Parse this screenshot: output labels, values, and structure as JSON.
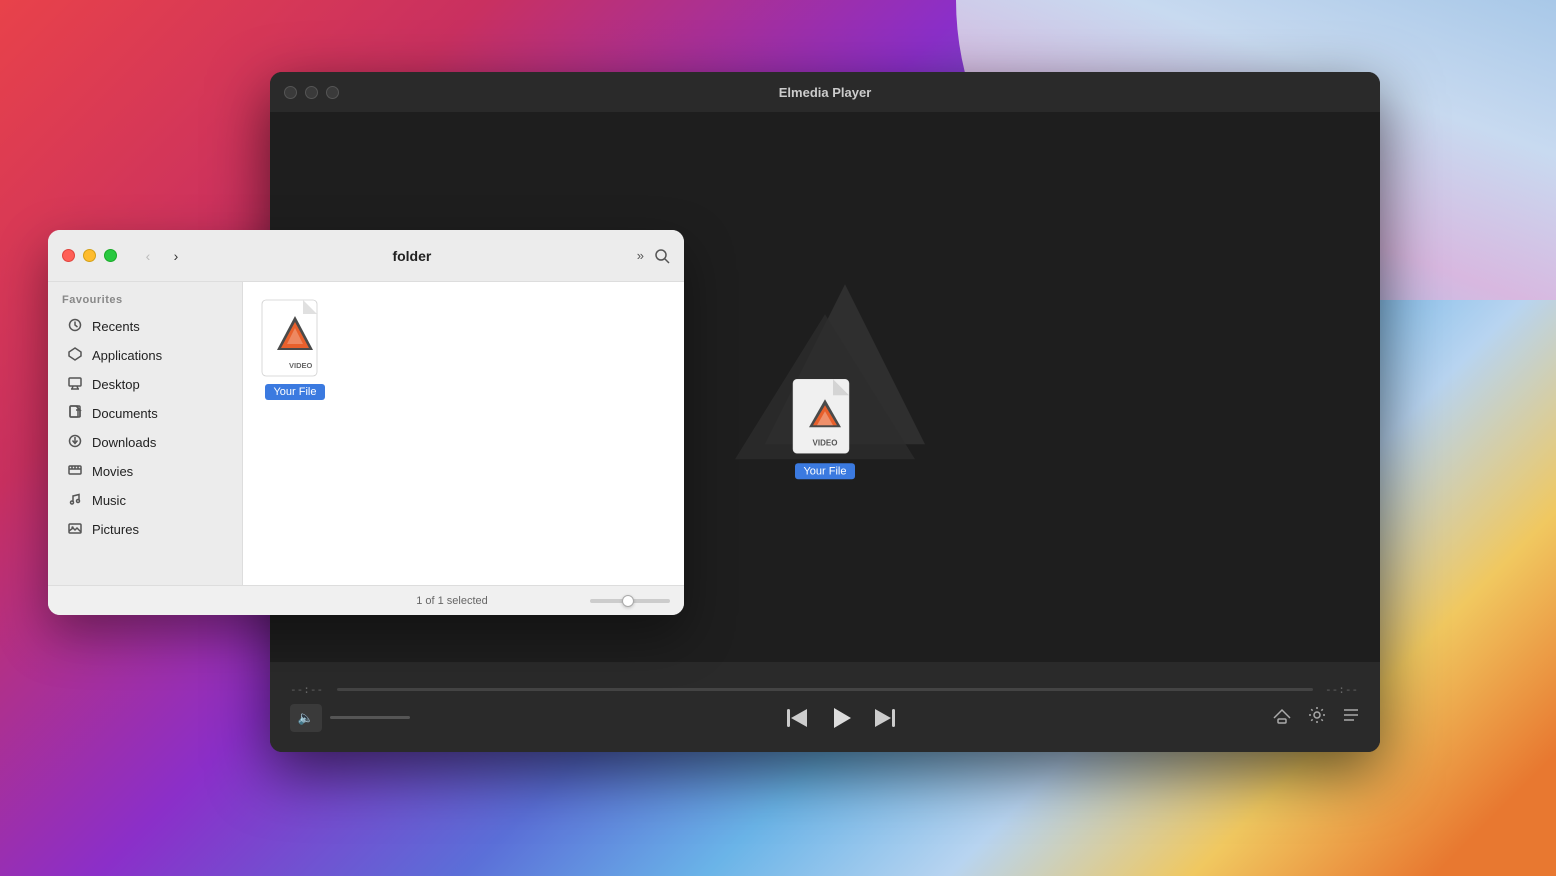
{
  "wallpaper": {
    "description": "macOS Big Sur style wallpaper with colorful gradient"
  },
  "player_window": {
    "title": "Elmedia Player",
    "traffic_lights": {
      "close": "close",
      "minimize": "minimize",
      "maximize": "maximize"
    },
    "file_icon": {
      "label": "Your File",
      "type": "VIDEO"
    },
    "controls": {
      "time_start": "--:--",
      "time_end": "--:--",
      "prev_label": "prev",
      "play_label": "play",
      "next_label": "next",
      "airplay_label": "airplay",
      "settings_label": "settings",
      "playlist_label": "playlist"
    }
  },
  "finder_window": {
    "title": "folder",
    "traffic_lights": {
      "close": "close",
      "minimize": "minimize",
      "maximize": "maximize"
    },
    "sidebar": {
      "section_label": "Favourites",
      "items": [
        {
          "label": "Recents",
          "icon": "clock"
        },
        {
          "label": "Applications",
          "icon": "compass"
        },
        {
          "label": "Desktop",
          "icon": "monitor"
        },
        {
          "label": "Documents",
          "icon": "file"
        },
        {
          "label": "Downloads",
          "icon": "arrow-circle"
        },
        {
          "label": "Movies",
          "icon": "film"
        },
        {
          "label": "Music",
          "icon": "music-note"
        },
        {
          "label": "Pictures",
          "icon": "photo"
        }
      ]
    },
    "file": {
      "label": "Your File",
      "type": "VIDEO"
    },
    "statusbar": {
      "text": "1 of 1 selected"
    },
    "nav": {
      "back": "‹",
      "forward": "›",
      "more": "»",
      "search": "search"
    }
  }
}
